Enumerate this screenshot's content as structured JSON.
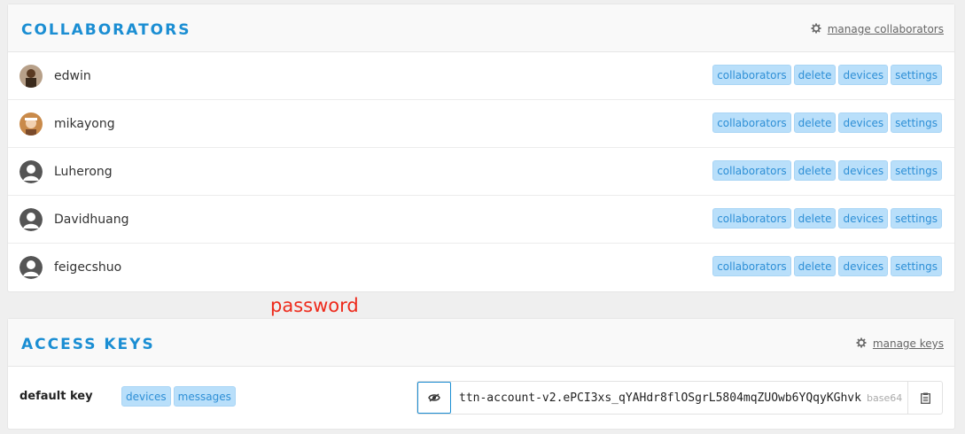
{
  "collaborators": {
    "title": "COLLABORATORS",
    "manage_label": "manage collaborators",
    "rows": [
      {
        "name": "edwin",
        "avatar": "photo-avatar"
      },
      {
        "name": "mikayong",
        "avatar": "photo-avatar"
      },
      {
        "name": "Luherong",
        "avatar": "default-user-icon"
      },
      {
        "name": "Davidhuang",
        "avatar": "default-user-icon"
      },
      {
        "name": "feigecshuo",
        "avatar": "default-user-icon"
      }
    ],
    "tags": [
      "collaborators",
      "delete",
      "devices",
      "settings"
    ]
  },
  "annotation": {
    "text": "password",
    "color": "#ee2a1b"
  },
  "access_keys": {
    "title": "ACCESS KEYS",
    "manage_label": "manage keys",
    "key": {
      "name": "default key",
      "tags": [
        "devices",
        "messages"
      ],
      "value": "ttn-account-v2.ePCI3xs_qYAHdr8flOSgrL5804mqZUOwb6YQqyKGhvk",
      "format": "base64",
      "reveal_icon": "eye-icon",
      "copy_icon": "clipboard-icon"
    }
  },
  "colors": {
    "accent": "#1b8ed3",
    "tag_bg": "#b9dffa",
    "annotation": "#ee2a1b"
  }
}
